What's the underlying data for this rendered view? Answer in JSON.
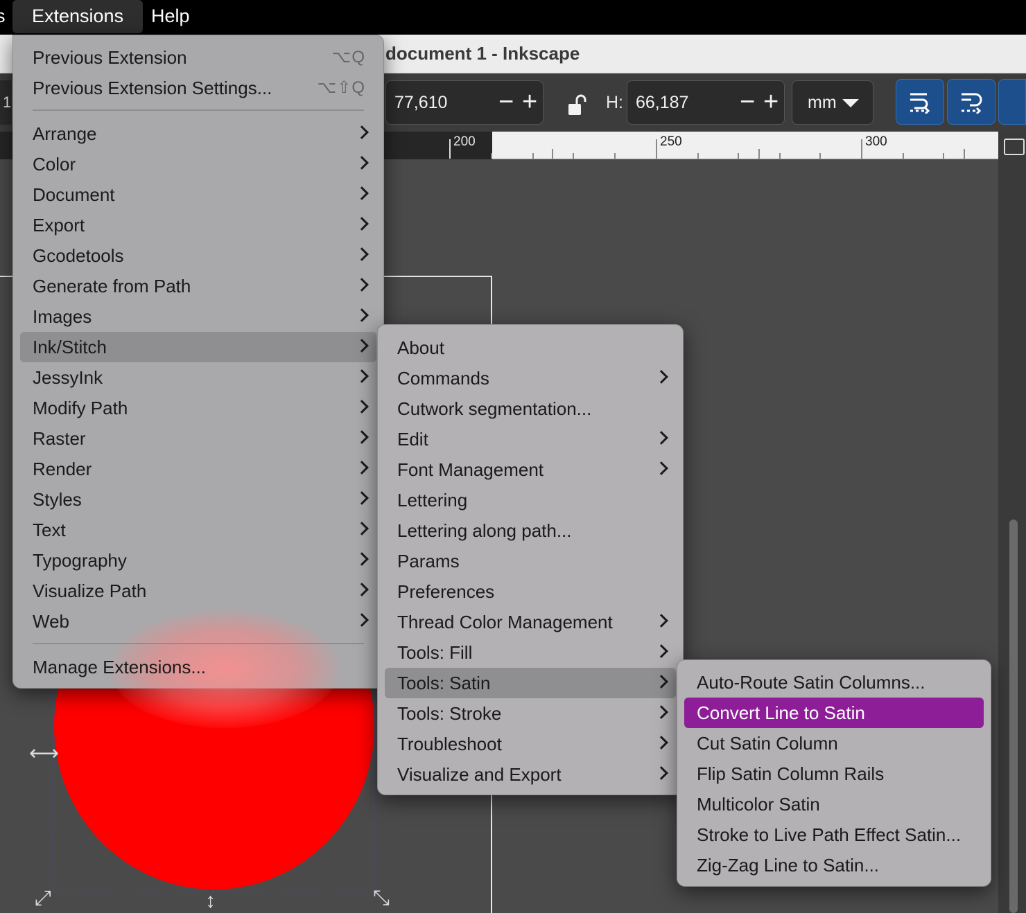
{
  "menubar": {
    "edge_char": "s",
    "items": [
      {
        "label": "Extensions",
        "active": true
      },
      {
        "label": "Help",
        "active": false
      }
    ]
  },
  "window": {
    "title": "document 1 - Inkscape"
  },
  "toolbar": {
    "left_value": "1",
    "w_value": "77,610",
    "h_label": "H:",
    "h_value": "66,187",
    "minus": "−",
    "plus": "+",
    "unit": "mm"
  },
  "ruler": {
    "labels": [
      "200",
      "250",
      "300"
    ]
  },
  "extensions_menu": {
    "top_items": [
      {
        "label": "Previous Extension",
        "shortcut": "⌥Q"
      },
      {
        "label": "Previous Extension Settings...",
        "shortcut": "⌥⇧Q"
      }
    ],
    "items": [
      {
        "label": "Arrange"
      },
      {
        "label": "Color"
      },
      {
        "label": "Document"
      },
      {
        "label": "Export"
      },
      {
        "label": "Gcodetools"
      },
      {
        "label": "Generate from Path"
      },
      {
        "label": "Images"
      },
      {
        "label": "Ink/Stitch"
      },
      {
        "label": "JessyInk"
      },
      {
        "label": "Modify Path"
      },
      {
        "label": "Raster"
      },
      {
        "label": "Render"
      },
      {
        "label": "Styles"
      },
      {
        "label": "Text"
      },
      {
        "label": "Typography"
      },
      {
        "label": "Visualize Path"
      },
      {
        "label": "Web"
      }
    ],
    "footer": {
      "label": "Manage Extensions..."
    }
  },
  "inkstitch_menu": {
    "items": [
      {
        "label": "About",
        "submenu": false
      },
      {
        "label": "Commands",
        "submenu": true
      },
      {
        "label": "Cutwork segmentation...",
        "submenu": false
      },
      {
        "label": "Edit",
        "submenu": true
      },
      {
        "label": "Font Management",
        "submenu": true
      },
      {
        "label": "Lettering",
        "submenu": false
      },
      {
        "label": "Lettering along path...",
        "submenu": false
      },
      {
        "label": "Params",
        "submenu": false
      },
      {
        "label": "Preferences",
        "submenu": false
      },
      {
        "label": "Thread Color Management",
        "submenu": true
      },
      {
        "label": "Tools: Fill",
        "submenu": true
      },
      {
        "label": "Tools: Satin",
        "submenu": true
      },
      {
        "label": "Tools: Stroke",
        "submenu": true
      },
      {
        "label": "Troubleshoot",
        "submenu": true
      },
      {
        "label": "Visualize and Export",
        "submenu": true
      }
    ]
  },
  "satin_menu": {
    "items": [
      {
        "label": "Auto-Route Satin Columns..."
      },
      {
        "label": "Convert Line to Satin"
      },
      {
        "label": "Cut Satin Column"
      },
      {
        "label": "Flip Satin Column Rails"
      },
      {
        "label": "Multicolor Satin"
      },
      {
        "label": "Stroke to Live Path Effect Satin..."
      },
      {
        "label": "Zig-Zag Line to Satin..."
      }
    ]
  },
  "colors": {
    "selected_item": "#8e1e97",
    "ellipse_fill": "#ff0000",
    "toolbar_button": "#1d4f8c"
  },
  "icons": {
    "lock": "unlocked-padlock-icon",
    "align_buttons": [
      "align-flow-icon",
      "align-wrap-icon"
    ],
    "canvas_handles": [
      "scale-horizontal-arrow-icon",
      "scale-diagonal-arrow-icon",
      "scale-vertical-arrow-icon"
    ]
  }
}
